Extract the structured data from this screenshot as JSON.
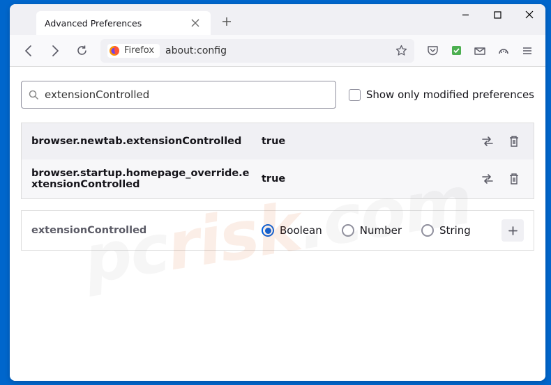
{
  "tab": {
    "title": "Advanced Preferences"
  },
  "urlbar": {
    "identity": "Firefox",
    "url": "about:config"
  },
  "search": {
    "value": "extensionControlled"
  },
  "checkbox": {
    "label": "Show only modified preferences"
  },
  "prefs": [
    {
      "name": "browser.newtab.extensionControlled",
      "value": "true"
    },
    {
      "name": "browser.startup.homepage_override.extensionControlled",
      "value": "true"
    }
  ],
  "newpref": {
    "name": "extensionControlled",
    "types": [
      "Boolean",
      "Number",
      "String"
    ]
  },
  "watermark": {
    "p1": "pc",
    "p2": "risk",
    "p3": ".com"
  }
}
